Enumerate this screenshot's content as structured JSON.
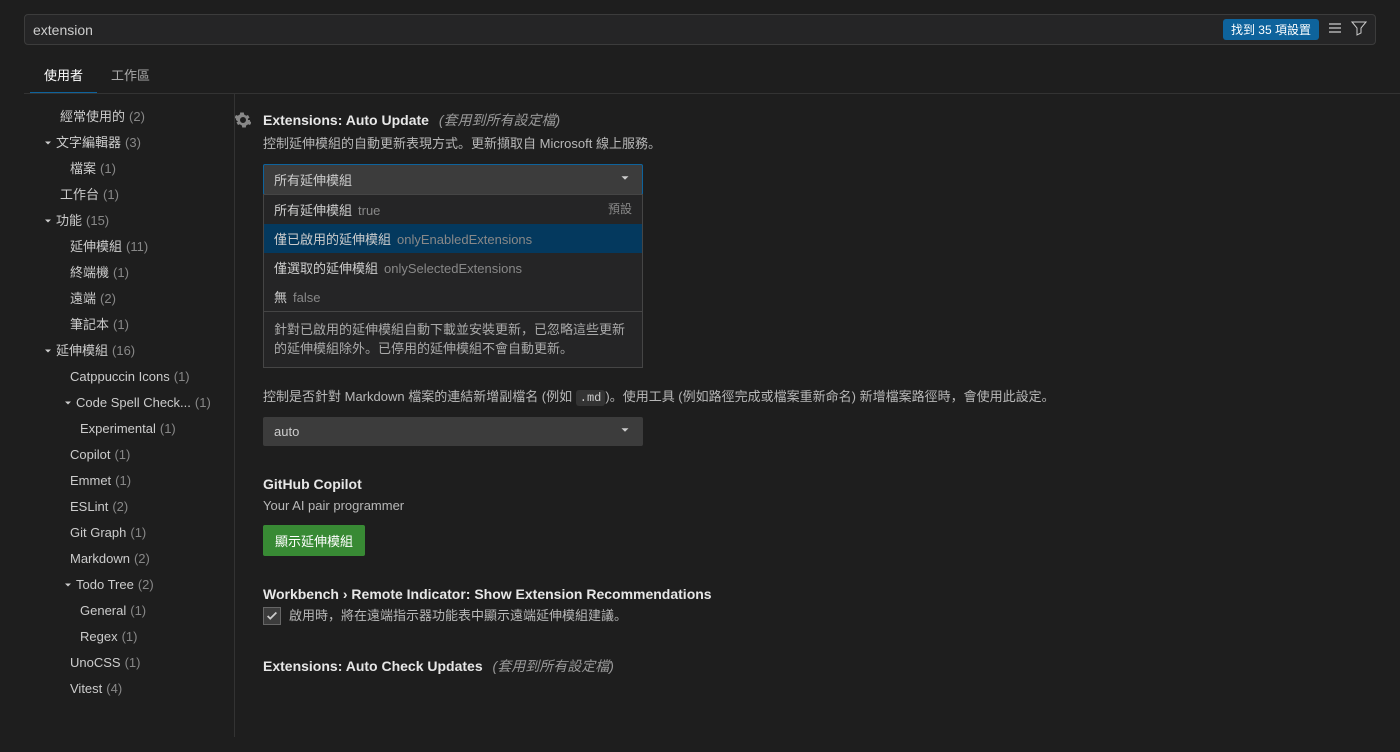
{
  "search": {
    "value": "extension",
    "result_badge": "找到 35 項設置"
  },
  "tabs": {
    "user": "使用者",
    "workspace": "工作區"
  },
  "sidebar": [
    {
      "label": "經常使用的",
      "count": "(2)",
      "indent": "indent-1b",
      "expandable": false
    },
    {
      "label": "文字編輯器",
      "count": "(3)",
      "indent": "indent-1",
      "expandable": true
    },
    {
      "label": "檔案",
      "count": "(1)",
      "indent": "indent-2",
      "expandable": false
    },
    {
      "label": "工作台",
      "count": "(1)",
      "indent": "indent-1b",
      "expandable": false
    },
    {
      "label": "功能",
      "count": "(15)",
      "indent": "indent-1",
      "expandable": true
    },
    {
      "label": "延伸模組",
      "count": "(11)",
      "indent": "indent-2",
      "expandable": false
    },
    {
      "label": "終端機",
      "count": "(1)",
      "indent": "indent-2",
      "expandable": false
    },
    {
      "label": "遠端",
      "count": "(2)",
      "indent": "indent-2",
      "expandable": false
    },
    {
      "label": "筆記本",
      "count": "(1)",
      "indent": "indent-2",
      "expandable": false
    },
    {
      "label": "延伸模組",
      "count": "(16)",
      "indent": "indent-1",
      "expandable": true
    },
    {
      "label": "Catppuccin Icons",
      "count": "(1)",
      "indent": "indent-2",
      "expandable": false
    },
    {
      "label": "Code Spell Check...",
      "count": "(1)",
      "indent": "indent-1b",
      "expandable": true,
      "indentChev": true
    },
    {
      "label": "Experimental",
      "count": "(1)",
      "indent": "indent-3",
      "expandable": false
    },
    {
      "label": "Copilot",
      "count": "(1)",
      "indent": "indent-2",
      "expandable": false
    },
    {
      "label": "Emmet",
      "count": "(1)",
      "indent": "indent-2",
      "expandable": false
    },
    {
      "label": "ESLint",
      "count": "(2)",
      "indent": "indent-2",
      "expandable": false
    },
    {
      "label": "Git Graph",
      "count": "(1)",
      "indent": "indent-2",
      "expandable": false
    },
    {
      "label": "Markdown",
      "count": "(2)",
      "indent": "indent-2",
      "expandable": false
    },
    {
      "label": "Todo Tree",
      "count": "(2)",
      "indent": "indent-1b",
      "expandable": true,
      "indentChev": true
    },
    {
      "label": "General",
      "count": "(1)",
      "indent": "indent-3",
      "expandable": false
    },
    {
      "label": "Regex",
      "count": "(1)",
      "indent": "indent-3",
      "expandable": false
    },
    {
      "label": "UnoCSS",
      "count": "(1)",
      "indent": "indent-2",
      "expandable": false
    },
    {
      "label": "Vitest",
      "count": "(4)",
      "indent": "indent-2",
      "expandable": false
    }
  ],
  "settings": {
    "autoUpdate": {
      "title": "Extensions: Auto Update",
      "scope": "(套用到所有設定檔)",
      "desc": "控制延伸模組的自動更新表現方式。更新擷取自 Microsoft 線上服務。",
      "selected": "所有延伸模組",
      "options": [
        {
          "label": "所有延伸模組",
          "extra": "true",
          "default": "預設"
        },
        {
          "label": "僅已啟用的延伸模組",
          "extra": "onlyEnabledExtensions",
          "highlighted": true
        },
        {
          "label": "僅選取的延伸模組",
          "extra": "onlySelectedExtensions"
        },
        {
          "label": "無",
          "extra": "false"
        }
      ],
      "optionDesc": "針對已啟用的延伸模組自動下載並安裝更新，已忽略這些更新的延伸模組除外。已停用的延伸模組不會自動更新。"
    },
    "markdown": {
      "desc_pre": "控制是否針對 Markdown 檔案的連結新增副檔名 (例如 ",
      "code": ".md",
      "desc_post": ")。使用工具 (例如路徑完成或檔案重新命名) 新增檔案路徑時，會使用此設定。",
      "selected": "auto"
    },
    "copilot": {
      "title": "GitHub Copilot",
      "desc": "Your AI pair programmer",
      "button": "顯示延伸模組"
    },
    "remote": {
      "title": "Workbench › Remote Indicator: Show Extension Recommendations",
      "desc": "啟用時，將在遠端指示器功能表中顯示遠端延伸模組建議。"
    },
    "autoCheck": {
      "title": "Extensions: Auto Check Updates",
      "scope": "(套用到所有設定檔)"
    }
  }
}
